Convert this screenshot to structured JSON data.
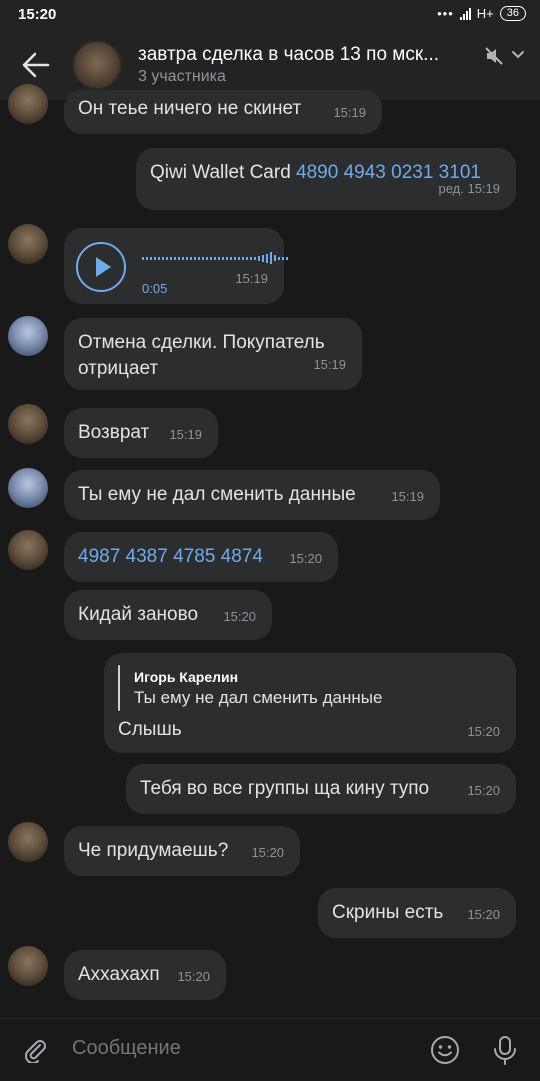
{
  "status": {
    "time": "15:20",
    "dots": "•••",
    "network": "H+",
    "battery": "36"
  },
  "header": {
    "title": "завтра сделка в часов 13 по мск...",
    "subtitle": "3 участника"
  },
  "messages": [
    {
      "text": "Он теье ничего не скинет",
      "time": "15:19"
    },
    {
      "text_prefix": "Qiwi Wallet Card ",
      "link": "4890 4943 0231 3101",
      "time": "ред. 15:19"
    },
    {
      "duration": "0:05",
      "time": "15:19"
    },
    {
      "line1": "Отмена сделки. Покупатель",
      "line2": "отрицает",
      "time": "15:19"
    },
    {
      "text": "Возврат",
      "time": "15:19"
    },
    {
      "text": "Ты ему не дал сменить данные",
      "time": "15:19"
    },
    {
      "link": "4987 4387 4785 4874",
      "time": "15:20"
    },
    {
      "text": "Кидай заново",
      "time": "15:20"
    },
    {
      "reply_name": "Игорь Карелин",
      "reply_text": "Ты ему не дал сменить данные",
      "text": "Слышь",
      "time": "15:20"
    },
    {
      "text": "Тебя во все группы ща кину тупо",
      "time": "15:20"
    },
    {
      "text": "Че придумаешь?",
      "time": "15:20"
    },
    {
      "text": "Скрины есть",
      "time": "15:20"
    },
    {
      "text": "Аххахахп",
      "time": "15:20"
    }
  ],
  "composer": {
    "placeholder": "Сообщение"
  },
  "colors": {
    "bg": "#19191a",
    "bubble": "#2c2d2e",
    "accent": "#71aaeb"
  },
  "icons": [
    "back-arrow-icon",
    "mute-icon",
    "chevron-down-icon",
    "play-icon",
    "paperclip-icon",
    "smile-icon",
    "microphone-icon"
  ]
}
